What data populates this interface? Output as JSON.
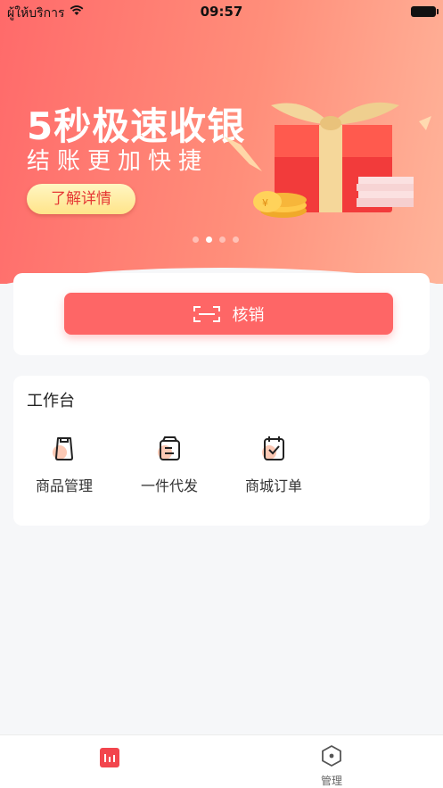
{
  "status_bar": {
    "carrier": "ผู้ให้บริการ",
    "time": "09:57"
  },
  "banner": {
    "headline": "5秒极速收银",
    "subline": "结账更加快捷",
    "cta_label": "了解详情",
    "page_count": 4,
    "active_page": 2
  },
  "verify": {
    "label": "核销"
  },
  "workbench": {
    "title": "工作台",
    "tools": [
      {
        "label": "商品管理",
        "icon": "product-icon"
      },
      {
        "label": "一件代发",
        "icon": "dropship-icon"
      },
      {
        "label": "商城订单",
        "icon": "order-icon"
      }
    ]
  },
  "tabbar": {
    "tabs": [
      {
        "label": "",
        "icon": "dashboard-icon"
      },
      {
        "label": "管理",
        "icon": "hexagon-icon"
      }
    ]
  },
  "colors": {
    "accent": "#fe6666",
    "tab_active": "#f2454d",
    "cta_text": "#e53935"
  }
}
